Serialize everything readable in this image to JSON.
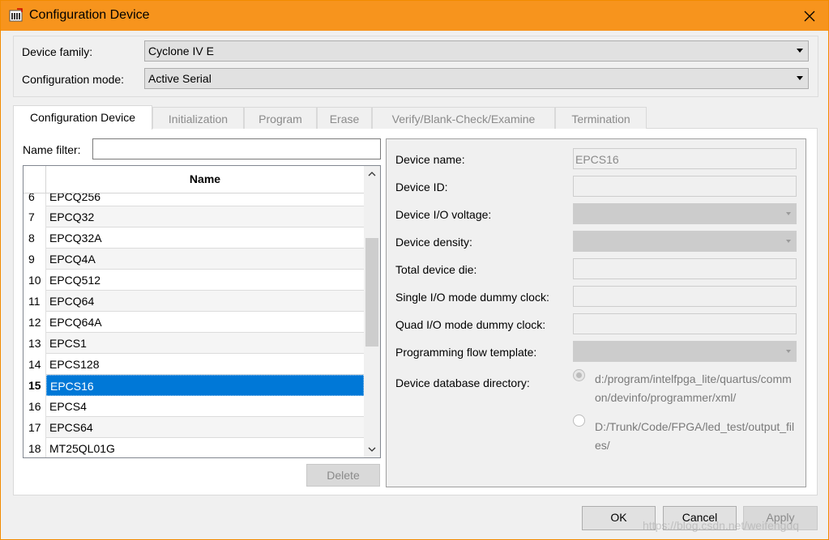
{
  "window": {
    "title": "Configuration Device",
    "titlebar_color": "#f7941d"
  },
  "device_family": {
    "label": "Device family:",
    "value": "Cyclone IV E"
  },
  "config_mode": {
    "label": "Configuration mode:",
    "value": "Active Serial"
  },
  "tabs": [
    {
      "label": "Configuration Device",
      "active": true
    },
    {
      "label": "Initialization",
      "active": false
    },
    {
      "label": "Program",
      "active": false
    },
    {
      "label": "Erase",
      "active": false
    },
    {
      "label": "Verify/Blank-Check/Examine",
      "active": false
    },
    {
      "label": "Termination",
      "active": false
    }
  ],
  "filter": {
    "label": "Name filter:",
    "value": ""
  },
  "device_list": {
    "header": "Name",
    "rows": [
      {
        "num": "6",
        "name": "EPCQ256"
      },
      {
        "num": "7",
        "name": "EPCQ32"
      },
      {
        "num": "8",
        "name": "EPCQ32A"
      },
      {
        "num": "9",
        "name": "EPCQ4A"
      },
      {
        "num": "10",
        "name": "EPCQ512"
      },
      {
        "num": "11",
        "name": "EPCQ64"
      },
      {
        "num": "12",
        "name": "EPCQ64A"
      },
      {
        "num": "13",
        "name": "EPCS1"
      },
      {
        "num": "14",
        "name": "EPCS128"
      },
      {
        "num": "15",
        "name": "EPCS16",
        "selected": true
      },
      {
        "num": "16",
        "name": "EPCS4"
      },
      {
        "num": "17",
        "name": "EPCS64"
      },
      {
        "num": "18",
        "name": "MT25QL01G"
      }
    ],
    "selected_color": "#0078d7"
  },
  "delete_button": "Delete",
  "details": {
    "device_name": {
      "label": "Device name:",
      "value": "EPCS16"
    },
    "device_id": {
      "label": "Device ID:",
      "value": ""
    },
    "io_voltage": {
      "label": "Device I/O voltage:"
    },
    "density": {
      "label": "Device density:"
    },
    "total_die": {
      "label": "Total device die:",
      "value": ""
    },
    "single_io": {
      "label": "Single I/O mode dummy clock:",
      "value": ""
    },
    "quad_io": {
      "label": "Quad I/O mode dummy clock:",
      "value": ""
    },
    "flow_template": {
      "label": "Programming flow template:"
    },
    "db_dir": {
      "label": "Device database directory:",
      "option1": "d:/program/intelfpga_lite/quartus/common/devinfo/programmer/xml/",
      "option2": "D:/Trunk/Code/FPGA/led_test/output_files/"
    }
  },
  "buttons": {
    "ok": "OK",
    "cancel": "Cancel",
    "apply": "Apply"
  },
  "watermark": "https://blog.csdn.net/weifengdq"
}
